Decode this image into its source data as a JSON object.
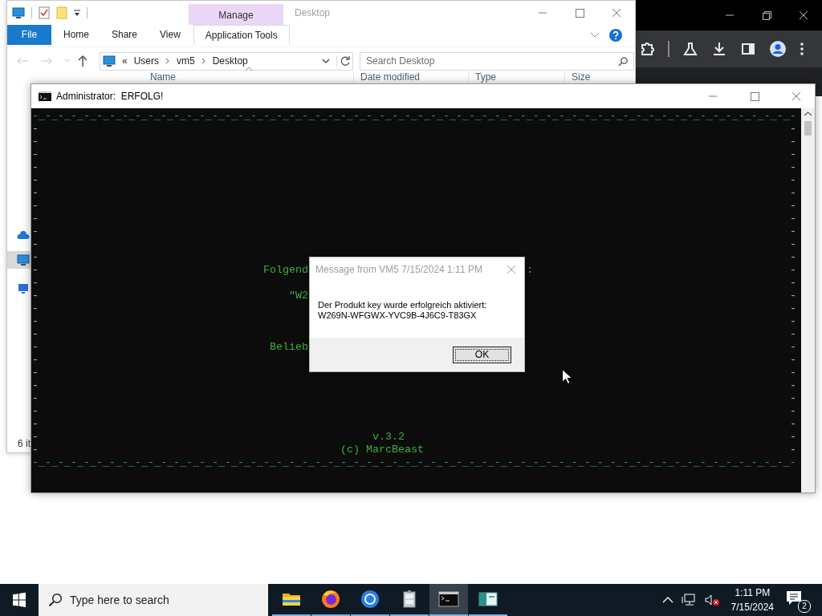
{
  "explorer": {
    "title": "Desktop",
    "context_tab": "Manage",
    "ribbon_tabs": [
      {
        "label": "File",
        "kind": "file"
      },
      {
        "label": "Home",
        "kind": "plain"
      },
      {
        "label": "Share",
        "kind": "plain"
      },
      {
        "label": "View",
        "kind": "plain"
      },
      {
        "label": "Application Tools",
        "kind": "context"
      }
    ],
    "breadcrumb": [
      "«",
      "Users",
      "vm5",
      "Desktop"
    ],
    "search": {
      "placeholder": "Search Desktop"
    },
    "columns": [
      "Name",
      "Date modified",
      "Type",
      "Size"
    ],
    "nav_items": [
      {
        "kind": "cloud",
        "selected": false
      },
      {
        "kind": "pc",
        "selected": true
      },
      {
        "kind": "network",
        "selected": false
      }
    ],
    "status_bar": "6 it"
  },
  "console": {
    "title": "Administrator:  ERFOLG!",
    "rows": [
      {
        "kind": "border",
        "text": "-_-_-_-_-_-_-_-_-_-_-_-_-_-_-_-_-_-_-_-_-_-_-_-_-_-_-_-_-_-_-_-_-_-_-_-_-_-_-_-_-_-_-_-_-_-_-_-_-_-_-_-_-_-_-_-_-_-_-_-"
      },
      {
        "kind": "side",
        "left": "-",
        "right": "-"
      },
      {
        "kind": "side",
        "left": "-",
        "right": "-"
      },
      {
        "kind": "side",
        "left": "-",
        "right": "-"
      },
      {
        "kind": "side",
        "left": "-",
        "right": "-"
      },
      {
        "kind": "side",
        "left": "-",
        "right": "-"
      },
      {
        "kind": "side",
        "left": "-",
        "right": "-"
      },
      {
        "kind": "side",
        "left": "-",
        "right": "-"
      },
      {
        "kind": "side",
        "left": "-",
        "right": "-"
      },
      {
        "kind": "side",
        "left": "-",
        "right": "-"
      },
      {
        "kind": "side",
        "left": "-",
        "right": "-"
      },
      {
        "kind": "side",
        "left": "-",
        "right": "-"
      },
      {
        "kind": "side",
        "left": "-",
        "middle": "                                   Folgend                                  :",
        "right": "-"
      },
      {
        "kind": "side",
        "left": "-",
        "right": "-"
      },
      {
        "kind": "side",
        "left": "-",
        "middle": "                                       \"W2",
        "right": "-"
      },
      {
        "kind": "side",
        "left": "-",
        "right": "-"
      },
      {
        "kind": "side",
        "left": "-",
        "right": "-"
      },
      {
        "kind": "side",
        "left": "-",
        "right": "-"
      },
      {
        "kind": "side",
        "left": "-",
        "middle": "                                    Belieb",
        "right": "-"
      },
      {
        "kind": "side",
        "left": "-",
        "right": "-"
      },
      {
        "kind": "side",
        "left": "-",
        "right": "-"
      },
      {
        "kind": "side",
        "left": "-",
        "right": "-"
      },
      {
        "kind": "side",
        "left": "-",
        "right": "-"
      },
      {
        "kind": "side",
        "left": "-",
        "right": "-"
      },
      {
        "kind": "side",
        "left": "-",
        "right": "-"
      },
      {
        "kind": "side",
        "left": "-",
        "middle": "                                                    v.3.2",
        "right": "-"
      },
      {
        "kind": "side",
        "left": "-",
        "middle": "                                               (c) MarcBeast",
        "right": "-"
      },
      {
        "kind": "border",
        "text": "-_-_-_-_-_-_-_-_-_-_-_-_-_-_-_-_-_-_-_-_-_-_-_-_-_-_-_-_-_-_-_-_-_-_-_-_-_-_-_-_-_-_-_-_-_-_-_-_-_-_-_-_-_-_-_-_-_-_-_-"
      }
    ]
  },
  "dialog": {
    "title": "Message from VM5 7/15/2024 1:11 PM",
    "message": [
      "Der Produkt key wurde erfolgreich aktiviert:",
      "W269N-WFGWX-YVC9B-4J6C9-T83GX"
    ],
    "button": "OK"
  },
  "taskbar": {
    "search_placeholder": "Type here to search",
    "apps": [
      {
        "kind": "folder",
        "active": false
      },
      {
        "kind": "firefox",
        "active": false
      },
      {
        "kind": "chrome",
        "active": false
      },
      {
        "kind": "cabinet",
        "active": false
      },
      {
        "kind": "terminal",
        "active": true
      },
      {
        "kind": "window",
        "active": false
      }
    ],
    "time": "1:11 PM",
    "date": "7/15/2024",
    "notifications": "2"
  }
}
